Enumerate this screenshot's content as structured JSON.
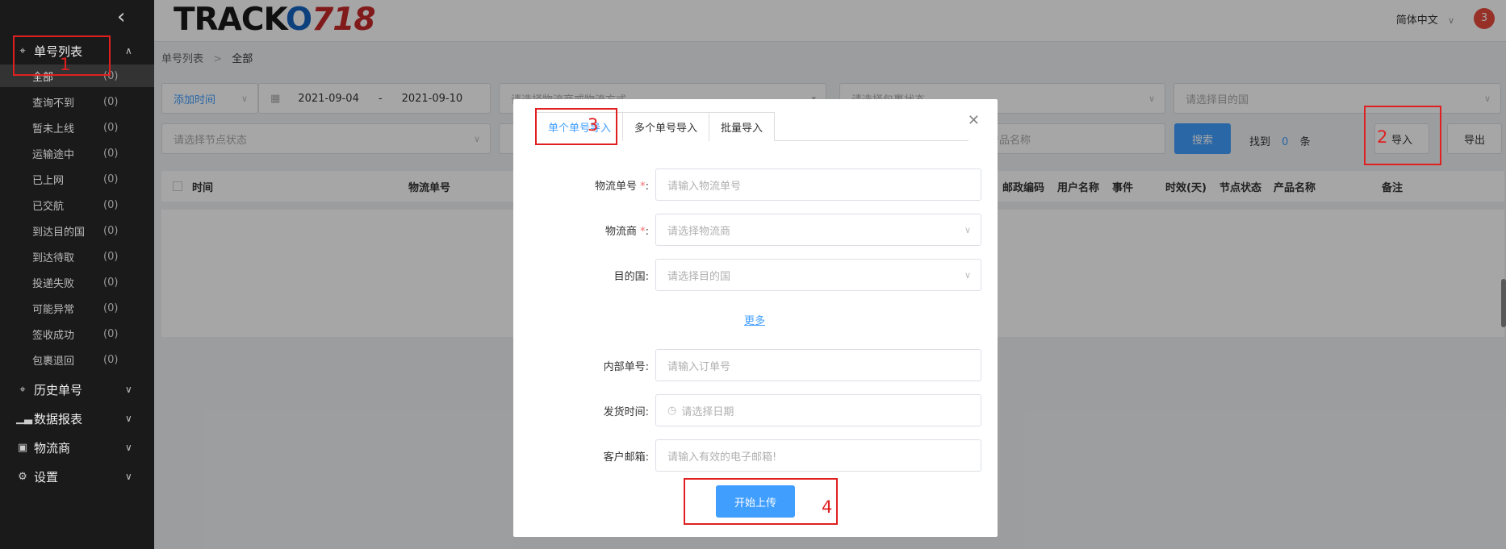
{
  "sidebar": {
    "collapse_icon": "chevron-left-icon",
    "groups": [
      {
        "label": "单号列表",
        "icon": "target-icon",
        "expanded": true
      },
      {
        "label": "历史单号",
        "icon": "target-icon",
        "expanded": false
      },
      {
        "label": "数据报表",
        "icon": "bar-chart-icon",
        "expanded": false
      },
      {
        "label": "物流商",
        "icon": "truck-icon",
        "expanded": false
      },
      {
        "label": "设置",
        "icon": "gear-icon",
        "expanded": false
      }
    ],
    "items": [
      {
        "label": "全部",
        "count": "(0)"
      },
      {
        "label": "查询不到",
        "count": "(0)"
      },
      {
        "label": "暂未上线",
        "count": "(0)"
      },
      {
        "label": "运输途中",
        "count": "(0)"
      },
      {
        "label": "已上网",
        "count": "(0)"
      },
      {
        "label": "已交航",
        "count": "(0)"
      },
      {
        "label": "到达目的国",
        "count": "(0)"
      },
      {
        "label": "到达待取",
        "count": "(0)"
      },
      {
        "label": "投递失败",
        "count": "(0)"
      },
      {
        "label": "可能异常",
        "count": "(0)"
      },
      {
        "label": "签收成功",
        "count": "(0)"
      },
      {
        "label": "包裹退回",
        "count": "(0)"
      }
    ]
  },
  "header": {
    "logo_text": "TRACK",
    "logo_o": "O",
    "logo_num": "718",
    "language": "简体中文",
    "notification_count": "3"
  },
  "breadcrumb": {
    "parent": "单号列表",
    "separator": ">",
    "current": "全部"
  },
  "filters": {
    "time_type": "添加时间",
    "date_start": "2021-09-04",
    "date_sep": "-",
    "date_end": "2021-09-10",
    "carrier_placeholder": "请选择物流商或物流方式",
    "package_status_placeholder": "请选择包裹状态",
    "dest_country_placeholder": "请选择目的国",
    "node_status_placeholder": "请选择节点状态",
    "product_name_placeholder": "产品名称",
    "search_label": "搜索",
    "found_prefix": "找到",
    "found_count": "0",
    "found_suffix": "条",
    "import_label": "导入",
    "export_label": "导出"
  },
  "table": {
    "columns": [
      "时间",
      "物流单号",
      "邮政编码",
      "用户名称",
      "事件",
      "时效(天)",
      "节点状态",
      "产品名称",
      "备注"
    ]
  },
  "modal": {
    "tabs": [
      "单个单号导入",
      "多个单号导入",
      "批量导入"
    ],
    "active_tab": 0,
    "fields": {
      "tracking_no": {
        "label": "物流单号",
        "required": "*",
        "placeholder": "请输入物流单号"
      },
      "carrier": {
        "label": "物流商",
        "required": "*",
        "placeholder": "请选择物流商"
      },
      "dest_country": {
        "label": "目的国:",
        "placeholder": "请选择目的国"
      },
      "internal_no": {
        "label": "内部单号:",
        "placeholder": "请输入订单号"
      },
      "ship_date": {
        "label": "发货时间:",
        "placeholder": "请选择日期"
      },
      "email": {
        "label": "客户邮箱:",
        "placeholder": "请输入有效的电子邮箱!"
      }
    },
    "more_link": "更多",
    "upload_button": "开始上传"
  },
  "annotations": [
    "1",
    "2",
    "3",
    "4"
  ],
  "colors": {
    "accent": "#409eff",
    "annotation": "#e02020",
    "sidebar_bg": "#1a1a1a"
  }
}
